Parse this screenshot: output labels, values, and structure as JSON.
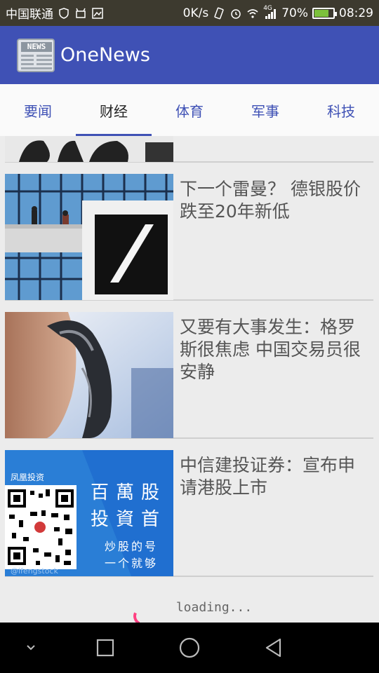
{
  "status_bar": {
    "carrier": "中国联通",
    "speed": "0K/s",
    "network": "4G",
    "battery": "70%",
    "battery_level": 0.7,
    "time": "08:29"
  },
  "app_bar": {
    "logo_text": "NEWS",
    "title": "OneNews",
    "color": "#3f51b5"
  },
  "tabs": [
    {
      "label": "要闻",
      "active": false
    },
    {
      "label": "财经",
      "active": true
    },
    {
      "label": "体育",
      "active": false
    },
    {
      "label": "军事",
      "active": false
    },
    {
      "label": "科技",
      "active": false
    }
  ],
  "news": [
    {
      "title": ""
    },
    {
      "title": "下一个雷曼？ 德银股价跌至20年新低"
    },
    {
      "title": "又要有大事发生：格罗斯很焦虑 中国交易员很安静"
    },
    {
      "title": "中信建投证券：宣布申请港股上市"
    }
  ],
  "qr_ad": {
    "brand": "凤凰投资",
    "slogan_1": "百萬股",
    "slogan_2": "投資首",
    "tagline_1": "炒股的号",
    "tagline_2": "一个就够",
    "handle": "@ifengstock"
  },
  "loading": {
    "text": "loading...",
    "accent": "#ff4081"
  },
  "nav": {
    "icons": [
      "chevron-down-icon",
      "recent-apps-icon",
      "home-icon",
      "back-icon"
    ]
  }
}
